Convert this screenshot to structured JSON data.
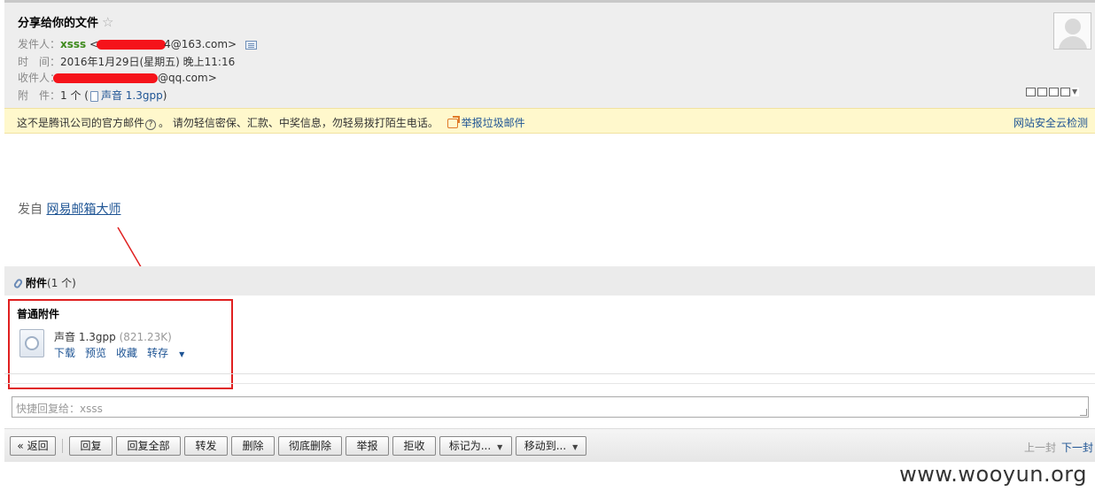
{
  "email": {
    "subject": "分享给你的文件",
    "star": "☆",
    "from_label": "发件人：",
    "from_name": "xsss",
    "from_email_open": "<",
    "from_email_tail": "4@163.com>",
    "time_label": "时　间：",
    "time_value": "2016年1月29日(星期五) 晚上11:16",
    "to_label": "收件人：",
    "to_email_tail": "@qq.com>",
    "attach_label": "附　件：",
    "attach_count": "1 个 (",
    "attach_name": "声音 1.3gpp",
    "attach_close": ")"
  },
  "warning": {
    "text_a": "这不是腾讯公司的官方邮件",
    "q": "?",
    "text_b": "。 请勿轻信密保、汇款、中奖信息，勿轻易拨打陌生电话。",
    "report": "举报垃圾邮件",
    "cloud_check": "网站安全云检测"
  },
  "body": {
    "sent_from_prefix": "发自 ",
    "sent_from_link": "网易邮箱大师"
  },
  "attachments": {
    "bar_label": "附件",
    "bar_count": "(1 个)",
    "section_title": "普通附件",
    "file_name": "声音 1.3gpp",
    "file_size": "(821.23K)",
    "actions": [
      "下载",
      "预览",
      "收藏",
      "转存"
    ]
  },
  "reply": {
    "placeholder": "快捷回复给：xsss"
  },
  "toolbar": {
    "back": "« 返回",
    "reply": "回复",
    "reply_all": "回复全部",
    "forward": "转发",
    "delete": "删除",
    "delete_perm": "彻底删除",
    "report": "举报",
    "reject": "拒收",
    "mark_as": "标记为...",
    "move_to": "移动到...",
    "prev": "上一封",
    "next": "下一封"
  },
  "watermark": "www.wooyun.org",
  "colors": {
    "accent_link": "#1e5494",
    "sender_green": "#3d8a1c",
    "warning_bg": "#fff8cc",
    "annotation_red": "#e02020"
  }
}
